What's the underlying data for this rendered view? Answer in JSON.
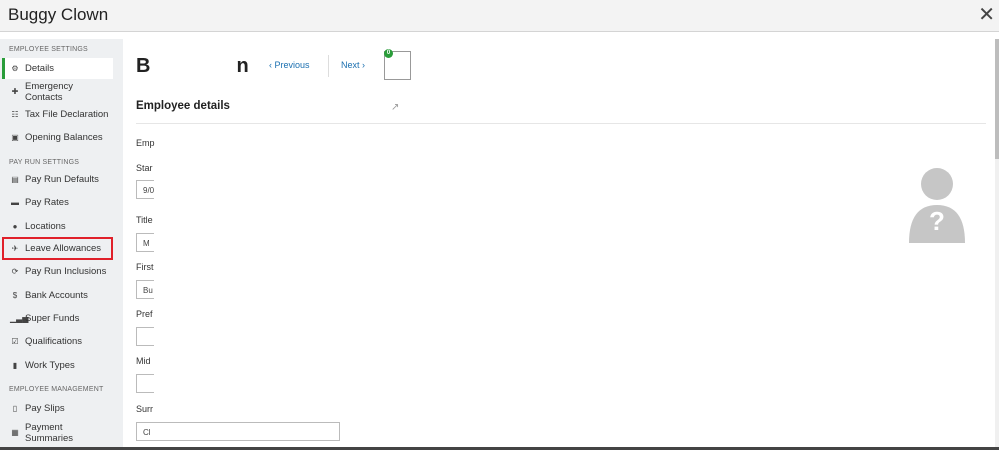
{
  "window": {
    "title": "Buggy Clown"
  },
  "sidebar": {
    "employee_settings_heading": "EMPLOYEE SETTINGS",
    "pay_run_settings_heading": "PAY RUN SETTINGS",
    "employee_management_heading": "EMPLOYEE MANAGEMENT",
    "items": [
      {
        "label": "Details",
        "icon": "gear-icon"
      },
      {
        "label": "Emergency Contacts",
        "icon": "plus-icon"
      },
      {
        "label": "Tax File Declaration",
        "icon": "bank-icon"
      },
      {
        "label": "Opening Balances",
        "icon": "ledger-icon"
      },
      {
        "label": "Pay Run Defaults",
        "icon": "clipboard-icon"
      },
      {
        "label": "Pay Rates",
        "icon": "money-icon"
      },
      {
        "label": "Locations",
        "icon": "globe-icon"
      },
      {
        "label": "Leave Allowances",
        "icon": "plane-icon"
      },
      {
        "label": "Pay Run Inclusions",
        "icon": "refresh-icon"
      },
      {
        "label": "Bank Accounts",
        "icon": "dollar-circle-icon"
      },
      {
        "label": "Super Funds",
        "icon": "signal-bars-icon"
      },
      {
        "label": "Qualifications",
        "icon": "check-square-icon"
      },
      {
        "label": "Work Types",
        "icon": "book-icon"
      },
      {
        "label": "Pay Slips",
        "icon": "document-icon"
      },
      {
        "label": "Payment Summaries",
        "icon": "calculator-icon"
      }
    ]
  },
  "header": {
    "employee_name_visible": "B",
    "employee_name_tail": "n",
    "prev_label": "Previous",
    "next_label": "Next",
    "badge_count": "0"
  },
  "main": {
    "section_title": "Employee details",
    "fields": [
      {
        "label": "Emp",
        "value": ""
      },
      {
        "label": "Star",
        "value": "9/0"
      },
      {
        "label": "Title",
        "value": "M"
      },
      {
        "label": "First",
        "value": "Bu"
      },
      {
        "label": "Pref",
        "value": ""
      },
      {
        "label": "Mid",
        "value": ""
      },
      {
        "label": "Surr",
        "value": "Cl"
      }
    ]
  },
  "colors": {
    "accent": "#2a9d3a",
    "link": "#1a6fb0",
    "highlight": "#e0202a"
  }
}
